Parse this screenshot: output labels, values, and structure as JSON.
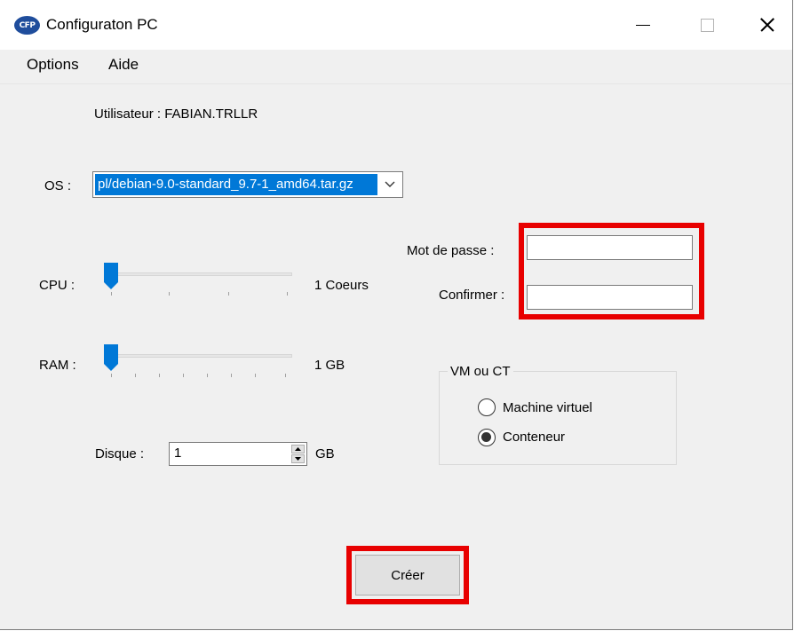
{
  "window": {
    "title": "Configuraton PC",
    "icon_text": "CFP",
    "icon_color": "#1f4d9c"
  },
  "menu": {
    "items": [
      {
        "label": "Options"
      },
      {
        "label": "Aide"
      }
    ]
  },
  "user": {
    "label": "Utilisateur : FABIAN.TRLLR"
  },
  "os": {
    "label": "OS :",
    "selected": "pl/debian-9.0-standard_9.7-1_amd64.tar.gz",
    "highlight_color": "#0078d7"
  },
  "cpu": {
    "label": "CPU :",
    "value_text": "1 Coeurs",
    "level": 0
  },
  "ram": {
    "label": "RAM :",
    "value_text": "1 GB",
    "level": 0
  },
  "password": {
    "label": "Mot de passe :",
    "value": ""
  },
  "confirm": {
    "label": "Confirmer :",
    "value": ""
  },
  "vm_group": {
    "legend": "VM ou CT",
    "options": [
      {
        "label": "Machine virtuel",
        "checked": false
      },
      {
        "label": "Conteneur",
        "checked": true
      }
    ]
  },
  "disk": {
    "label": "Disque :",
    "value": "1",
    "unit": "GB"
  },
  "create_button": {
    "label": "Créer"
  },
  "highlight": {
    "color": "#e80000"
  },
  "icons": [
    "app-icon",
    "minimize-icon",
    "maximize-icon",
    "close-icon",
    "chevron-down-icon",
    "stepper-up-icon",
    "stepper-down-icon"
  ]
}
